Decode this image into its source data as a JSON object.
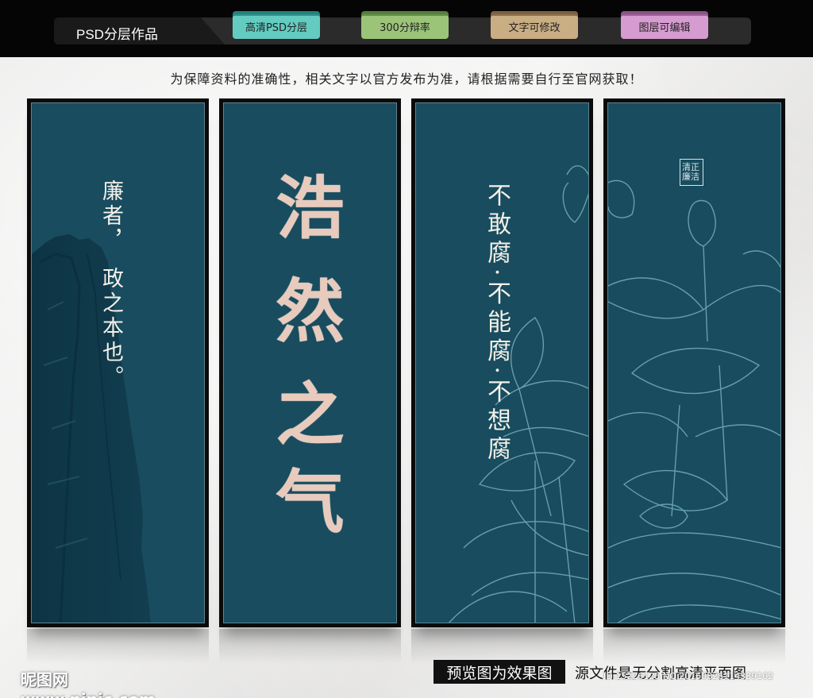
{
  "header": {
    "brand": "PSD分层作品",
    "tags": [
      "高清PSD分层",
      "300分辩率",
      "文字可修改",
      "图层可编辑"
    ],
    "tag_colors": [
      "#63cbc0",
      "#9bc478",
      "#c9ad83",
      "#d69bd0"
    ]
  },
  "notice": "为保障资料的准确性，相关文字以官方发布为准，请根据需要自行至官网获取！",
  "panels": {
    "panel1": {
      "line1": "廉者，",
      "line2": "政之本也。"
    },
    "panel2": {
      "chars": [
        "浩",
        "然",
        "之",
        "气"
      ]
    },
    "panel3": {
      "text": "不敢腐·不能腐·不想腐"
    },
    "panel4": {
      "seal": "清正廉洁"
    }
  },
  "colors": {
    "panel_bg": "#184c5e",
    "lotus_line": "#6fa8b4",
    "title_color": "#e8cbbd"
  },
  "footer": {
    "watermark": "昵图网 www.nipic.com",
    "preview_label": "预览图为效果图",
    "source_label": "源文件是无分割高清平面图",
    "id_text": "ID:15226125 NO:20160826114339102"
  }
}
